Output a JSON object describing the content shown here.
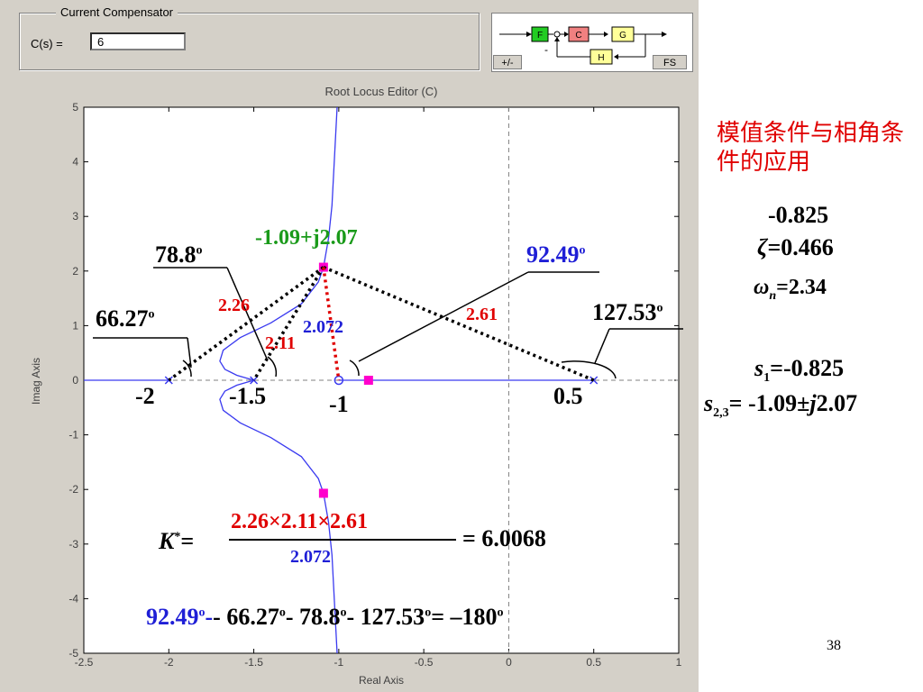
{
  "compensator": {
    "group_title": "Current Compensator",
    "cs_label": "C(s) =",
    "cs_value": "6"
  },
  "block_diagram": {
    "blocks": [
      "F",
      "C",
      "G",
      "H"
    ],
    "minus_sign": "-",
    "button_signs": "+/-",
    "button_fs": "FS"
  },
  "plot": {
    "title": "Root Locus Editor (C)",
    "xlabel": "Real Axis",
    "ylabel": "Imag Axis"
  },
  "chart_data": {
    "type": "line",
    "title": "Root Locus Editor (C)",
    "xlabel": "Real Axis",
    "ylabel": "Imag Axis",
    "xlim": [
      -2.5,
      1
    ],
    "ylim": [
      -5,
      5
    ],
    "xticks": [
      "-2.5",
      "-2",
      "-1.5",
      "-1",
      "-0.5",
      "0",
      "0.5",
      "1"
    ],
    "yticks": [
      "5",
      "4",
      "3",
      "2",
      "1",
      "0",
      "-1",
      "-2",
      "-3",
      "-4",
      "-5"
    ],
    "poles": [
      [
        -2,
        0
      ],
      [
        -1.5,
        0
      ],
      [
        0.5,
        0
      ]
    ],
    "zeros": [
      [
        -1,
        0
      ]
    ],
    "closed_loop_poles": [
      [
        -1.09,
        2.07
      ],
      [
        -1.09,
        -2.07
      ],
      [
        -0.825,
        0
      ]
    ],
    "locus_upper": [
      [
        -1.5,
        0
      ],
      [
        -1.6,
        0.09
      ],
      [
        -1.67,
        0.2
      ],
      [
        -1.7,
        0.35
      ],
      [
        -1.68,
        0.55
      ],
      [
        -1.58,
        0.78
      ],
      [
        -1.4,
        1.05
      ],
      [
        -1.22,
        1.4
      ],
      [
        -1.12,
        1.8
      ],
      [
        -1.09,
        2.07
      ],
      [
        -1.06,
        2.6
      ],
      [
        -1.04,
        3.2
      ],
      [
        -1.03,
        3.8
      ],
      [
        -1.02,
        4.4
      ],
      [
        -1.01,
        5
      ]
    ],
    "locus_lower": [
      [
        -1.5,
        0
      ],
      [
        -1.6,
        -0.09
      ],
      [
        -1.67,
        -0.2
      ],
      [
        -1.7,
        -0.35
      ],
      [
        -1.68,
        -0.55
      ],
      [
        -1.58,
        -0.78
      ],
      [
        -1.4,
        -1.05
      ],
      [
        -1.22,
        -1.4
      ],
      [
        -1.12,
        -1.8
      ],
      [
        -1.09,
        -2.07
      ],
      [
        -1.06,
        -2.6
      ],
      [
        -1.04,
        -3.2
      ],
      [
        -1.03,
        -3.8
      ],
      [
        -1.02,
        -4.4
      ],
      [
        -1.01,
        -5
      ]
    ],
    "locus_real_segments": [
      [
        -2.5,
        -2
      ],
      [
        -1,
        0.5
      ]
    ],
    "grid": false,
    "colors": {
      "locus": "#3a3af0",
      "marker": "#ff00cc",
      "dashed": "#808080"
    }
  },
  "annotations": {
    "point_label": "-1.09+j2.07",
    "angle_788": "78.8",
    "angle_6627": "66.27",
    "angle_9249": "92.49",
    "angle_12753": "127.53",
    "deg": "o",
    "len_226": "2.26",
    "len_211": "2.11",
    "len_2072": "2.072",
    "len_261": "2.61",
    "x_m2": "-2",
    "x_m15": "-1.5",
    "x_m1": "-1",
    "x_05": "0.5",
    "k_label": "K",
    "k_star": "*",
    "k_eq": "=",
    "k_numerator": "2.26×2.11×2.61",
    "k_denominator": "2.072",
    "k_result": "= 6.0068",
    "angle_eq_part1": "92.49",
    "angle_eq_part2": "- 66.27",
    "angle_eq_part3": "- 78.8",
    "angle_eq_part4": "- 127.53",
    "angle_eq_part5": "= –180"
  },
  "notes": {
    "title": "模值条件与相角条件的应用",
    "sigma": "-0.825",
    "zeta_sym": "ζ",
    "zeta_val": "=0.466",
    "omega_sym": "ω",
    "omega_sub": "n",
    "omega_val": "=2.34",
    "s1_sym": "s",
    "s1_sub": "1",
    "s1_val": "=-0.825",
    "s23_sym": "s",
    "s23_sub": "2,3",
    "s23_val": "= -1.09±",
    "s23_j": "j",
    "s23_val2": "2.07"
  },
  "page_number": "38"
}
